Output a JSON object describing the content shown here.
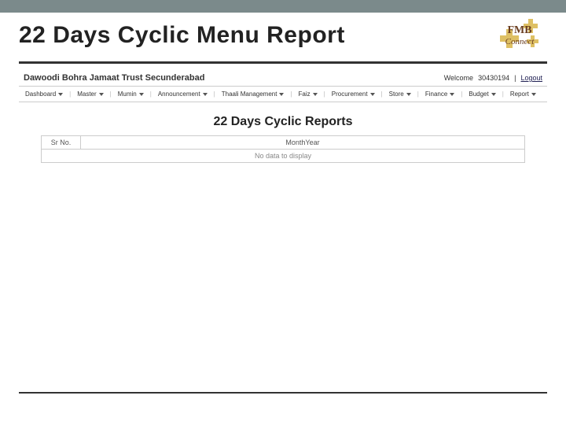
{
  "slide": {
    "title": "22 Days Cyclic Menu Report",
    "logo_text_top": "FMB",
    "logo_text_bottom": "Connect"
  },
  "app": {
    "org_name": "Dawoodi Bohra Jamaat Trust Secunderabad",
    "welcome_prefix": "Welcome",
    "user_id": "30430194",
    "logout_label": "Logout"
  },
  "menu": {
    "items": [
      "Dashboard",
      "Master",
      "Mumin",
      "Announcement",
      "Thaali Management",
      "Faiz",
      "Procurement",
      "Store",
      "Finance",
      "Budget",
      "Report"
    ]
  },
  "report": {
    "heading": "22 Days Cyclic Reports",
    "columns": {
      "srno": "Sr No.",
      "monthyear": "MonthYear"
    },
    "empty_message": "No data to display"
  }
}
